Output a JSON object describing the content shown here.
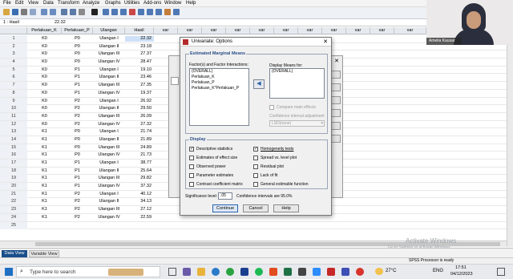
{
  "menu": [
    "File",
    "Edit",
    "View",
    "Data",
    "Transform",
    "Analyze",
    "Graphs",
    "Utilities",
    "Add-ons",
    "Window",
    "Help"
  ],
  "cell_editor": {
    "ref": "1 : Hasil",
    "value": "22.32"
  },
  "columns": [
    "Perlakuan_K",
    "Perlakuan_P",
    "Ulangan",
    "Hasil",
    "var",
    "var",
    "var",
    "var",
    "var",
    "var",
    "var",
    "var",
    "var",
    "var",
    "var"
  ],
  "rows": [
    [
      "1",
      "K0",
      "P0",
      "Ulangan I",
      "22.32"
    ],
    [
      "2",
      "K0",
      "P0",
      "Ulangan II",
      "23.18"
    ],
    [
      "3",
      "K0",
      "P0",
      "Ulangan III",
      "27.37"
    ],
    [
      "4",
      "K0",
      "P0",
      "Ulangan IV",
      "28.47"
    ],
    [
      "5",
      "K0",
      "P1",
      "Ulangan I",
      "19.10"
    ],
    [
      "6",
      "K0",
      "P1",
      "Ulangan II",
      "23.46"
    ],
    [
      "7",
      "K0",
      "P1",
      "Ulangan III",
      "27.35"
    ],
    [
      "8",
      "K0",
      "P1",
      "Ulangan IV",
      "19.37"
    ],
    [
      "9",
      "K0",
      "P2",
      "Ulangan I",
      "26.92"
    ],
    [
      "10",
      "K0",
      "P2",
      "Ulangan II",
      "29.50"
    ],
    [
      "11",
      "K0",
      "P2",
      "Ulangan III",
      "26.09"
    ],
    [
      "12",
      "K0",
      "P2",
      "Ulangan IV",
      "27.32"
    ],
    [
      "13",
      "K1",
      "P0",
      "Ulangan I",
      "21.74"
    ],
    [
      "14",
      "K1",
      "P0",
      "Ulangan II",
      "21.89"
    ],
    [
      "15",
      "K1",
      "P0",
      "Ulangan III",
      "24.89"
    ],
    [
      "16",
      "K1",
      "P0",
      "Ulangan IV",
      "21.73"
    ],
    [
      "17",
      "K1",
      "P1",
      "Ulangan I",
      "38.77"
    ],
    [
      "18",
      "K1",
      "P1",
      "Ulangan II",
      "25.64"
    ],
    [
      "19",
      "K1",
      "P1",
      "Ulangan III",
      "29.82"
    ],
    [
      "20",
      "K1",
      "P1",
      "Ulangan IV",
      "37.32"
    ],
    [
      "21",
      "K1",
      "P2",
      "Ulangan I",
      "40.12"
    ],
    [
      "22",
      "K1",
      "P2",
      "Ulangan II",
      "34.13"
    ],
    [
      "23",
      "K1",
      "P2",
      "Ulangan III",
      "27.12"
    ],
    [
      "24",
      "K1",
      "P2",
      "Ulangan IV",
      "22.59"
    ],
    [
      "25",
      "",
      "",
      "",
      ""
    ]
  ],
  "tabs": {
    "data_view": "Data View",
    "variable_view": "Variable View"
  },
  "status": "SPSS  Processor is ready",
  "watermark": {
    "line1": "Activate Windows",
    "line2": "Go to Settings to activate Windows."
  },
  "webcam": {
    "name": "Amelia Kausar"
  },
  "dialog": {
    "title": "Univariate: Options",
    "emm_title": "Estimated Marginal Means",
    "factors_label": "Factor(s) and Factor Interactions:",
    "factors": [
      "(OVERALL)",
      "Perlakuan_K",
      "Perlakuan_P",
      "Perlakuan_K*Perlakuan_P"
    ],
    "display_means_label": "Display Means for:",
    "display_means": [
      "(OVERALL)"
    ],
    "compare_main": "Compare main effects",
    "ci_adjust_label": "Confidence interval adjustment",
    "ci_adjust_value": "LSD(none)",
    "display_title": "Display",
    "options_left": [
      {
        "label": "Descriptive statistics",
        "checked": true
      },
      {
        "label": "Estimates of effect size",
        "checked": false
      },
      {
        "label": "Observed power",
        "checked": false
      },
      {
        "label": "Parameter estimates",
        "checked": false
      },
      {
        "label": "Contrast coefficient matrix",
        "checked": false
      }
    ],
    "options_right": [
      {
        "label": "Homogeneity tests",
        "checked": true
      },
      {
        "label": "Spread vs. level plot",
        "checked": false
      },
      {
        "label": "Residual plot",
        "checked": false
      },
      {
        "label": "Lack of fit",
        "checked": false
      },
      {
        "label": "General estimable function",
        "checked": false
      }
    ],
    "sig_label": "Significance level:",
    "sig_value": ".05",
    "ci_text": "Confidence intervals are 95.0%",
    "continue": "Continue",
    "cancel": "Cancel",
    "help": "Help"
  },
  "taskbar": {
    "search_placeholder": "Type here to search",
    "temp": "27°C",
    "lang": "ENG",
    "time": "17:51",
    "date": "04/12/2023"
  }
}
